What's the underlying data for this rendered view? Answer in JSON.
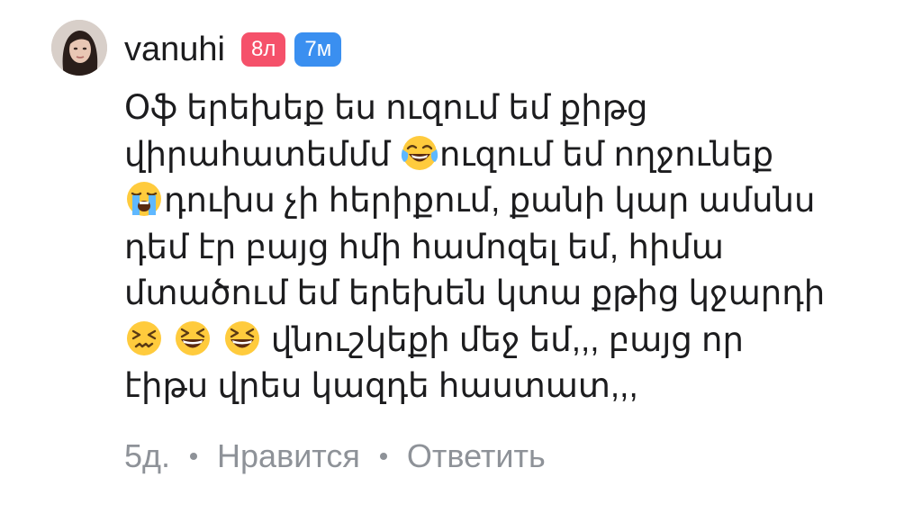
{
  "comment": {
    "author": "vanuhi",
    "badges": [
      {
        "label": "8л",
        "color": "#f5516a"
      },
      {
        "label": "7м",
        "color": "#3a8ff0"
      }
    ],
    "lines": {
      "l1": "Օֆ երեխեք ես ուզում եմ քիթց",
      "l2a": "վիրահատեմմմ ",
      "l2b": "ուզում եմ ողջունեք",
      "l3": "դուխս չի հերիքում, քանի կար ամսնս",
      "l4": "դեմ էր բայց հմի համոզել եմ, հիմա",
      "l5": "մտածում եմ երեխեն կտա քթից կջարդի",
      "l6": " վնուշկեքի մեջ եմ,,, բայց որ",
      "l7": "էիթս վրես կազդե հաստատ,,,"
    },
    "emojis": [
      "tears-of-joy",
      "loudly-crying",
      "confounded",
      "grinning-squinting",
      "grinning-squinting"
    ],
    "footer": {
      "time": "5д.",
      "like_label": "Нравится",
      "reply_label": "Ответить"
    }
  },
  "colors": {
    "text": "#1c1c1e",
    "muted": "#8e9298",
    "badge_pink": "#f5516a",
    "badge_blue": "#3a8ff0"
  }
}
